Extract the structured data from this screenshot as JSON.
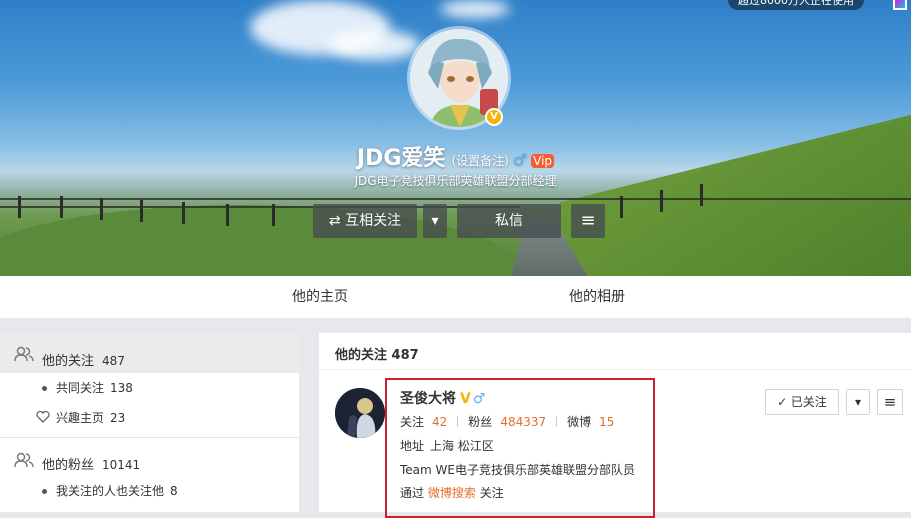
{
  "banner": {
    "top_badge": "超过8000万人正在使用",
    "name": "JDG爱笑",
    "remark": "(设置备注)",
    "gender_icon": "♂",
    "vip_badge": "Vip",
    "intro": "JDG电子竞技俱乐部英雄联盟分部经理",
    "buttons": {
      "mutual_follow": "⇄ 互相关注",
      "dropdown": "▾",
      "message": "私信",
      "menu": "≡"
    }
  },
  "tabs": {
    "home": "他的主页",
    "album": "他的相册"
  },
  "sidebar": {
    "following": {
      "label": "他的关注",
      "count": "487"
    },
    "common_follow": {
      "label": "共同关注",
      "count": "138"
    },
    "interest": {
      "label": "兴趣主页",
      "count": "23"
    },
    "fans": {
      "label": "他的粉丝",
      "count": "10141"
    },
    "known_fans": {
      "label": "我关注的人也关注他",
      "count": "8"
    }
  },
  "main": {
    "title": "他的关注 487",
    "user": {
      "name": "圣俊大将",
      "v_mark": "V",
      "gender": "♂",
      "follow_label": "关注",
      "follow_count": "42",
      "fans_label": "粉丝",
      "fans_count": "484337",
      "weibo_label": "微博",
      "weibo_count": "15",
      "address_label": "地址",
      "address": "上海 松江区",
      "bio": "Team WE电子竞技俱乐部英雄联盟分部队员",
      "via_prefix": "通过",
      "via_link": "微博搜索",
      "via_suffix": "关注"
    },
    "buttons": {
      "followed": "✓ 已关注",
      "dropdown": "▾",
      "menu": "≡"
    }
  },
  "colors": {
    "accent": "#e56d30",
    "highlight_box": "#c8232b",
    "verified": "#f4b400",
    "male": "#5bb2f0"
  }
}
